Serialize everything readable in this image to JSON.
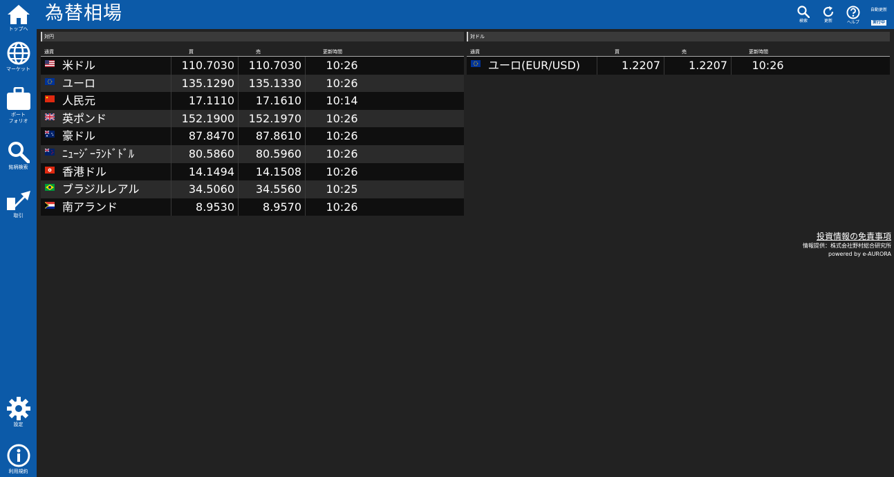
{
  "header": {
    "title": "為替相場",
    "buttons": [
      {
        "icon": "search-icon",
        "label": "検索"
      },
      {
        "icon": "refresh-icon",
        "label": "更新"
      },
      {
        "icon": "help-icon",
        "label": "ヘルプ"
      }
    ],
    "auto_update": {
      "label": "自動更新",
      "status": "実行中"
    }
  },
  "sidebar": {
    "items": [
      {
        "icon": "home-icon",
        "label": "トップへ"
      },
      {
        "icon": "globe-icon",
        "label": "マーケット"
      },
      {
        "icon": "briefcase-icon",
        "label": "ポート\nフォリオ"
      },
      {
        "icon": "search-icon",
        "label": "銘柄検索"
      },
      {
        "icon": "trade-icon",
        "label": "取引"
      },
      {
        "icon": "gear-icon",
        "label": "設定"
      },
      {
        "icon": "info-icon",
        "label": "利用規約"
      }
    ]
  },
  "yen_panel": {
    "title": "対円",
    "columns": {
      "currency": "通貨",
      "buy": "買",
      "sell": "売",
      "time": "更新時間"
    },
    "rows": [
      {
        "flag": "us",
        "name": "米ドル",
        "buy": "110.7030",
        "sell": "110.7030",
        "time": "10:26"
      },
      {
        "flag": "eu",
        "name": "ユーロ",
        "buy": "135.1290",
        "sell": "135.1330",
        "time": "10:26"
      },
      {
        "flag": "cn",
        "name": "人民元",
        "buy": "17.1110",
        "sell": "17.1610",
        "time": "10:14"
      },
      {
        "flag": "gb",
        "name": "英ポンド",
        "buy": "152.1900",
        "sell": "152.1970",
        "time": "10:26"
      },
      {
        "flag": "au",
        "name": "豪ドル",
        "buy": "87.8470",
        "sell": "87.8610",
        "time": "10:26"
      },
      {
        "flag": "nz",
        "name": "ﾆｭｰｼﾞｰﾗﾝﾄﾞﾄﾞﾙ",
        "buy": "80.5860",
        "sell": "80.5960",
        "time": "10:26"
      },
      {
        "flag": "hk",
        "name": "香港ドル",
        "buy": "14.1494",
        "sell": "14.1508",
        "time": "10:26"
      },
      {
        "flag": "br",
        "name": "ブラジルレアル",
        "buy": "34.5060",
        "sell": "34.5560",
        "time": "10:25"
      },
      {
        "flag": "za",
        "name": "南アランド",
        "buy": "8.9530",
        "sell": "8.9570",
        "time": "10:26"
      }
    ]
  },
  "usd_panel": {
    "title": "対ドル",
    "columns": {
      "currency": "通貨",
      "buy": "買",
      "sell": "売",
      "time": "更新時間"
    },
    "rows": [
      {
        "flag": "eu",
        "name": "ユーロ(EUR/USD)",
        "buy": "1.2207",
        "sell": "1.2207",
        "time": "10:26"
      }
    ]
  },
  "footer": {
    "disclaimer": "投資情報の免責事項",
    "provider": "情報提供：株式会社野村総合研究所",
    "powered": "powered by e-AURORA"
  },
  "colors": {
    "primary": "#0c5aa8",
    "background": "#222222",
    "row_dark": "#0f0f0f",
    "row_light": "#2b2b2b"
  }
}
